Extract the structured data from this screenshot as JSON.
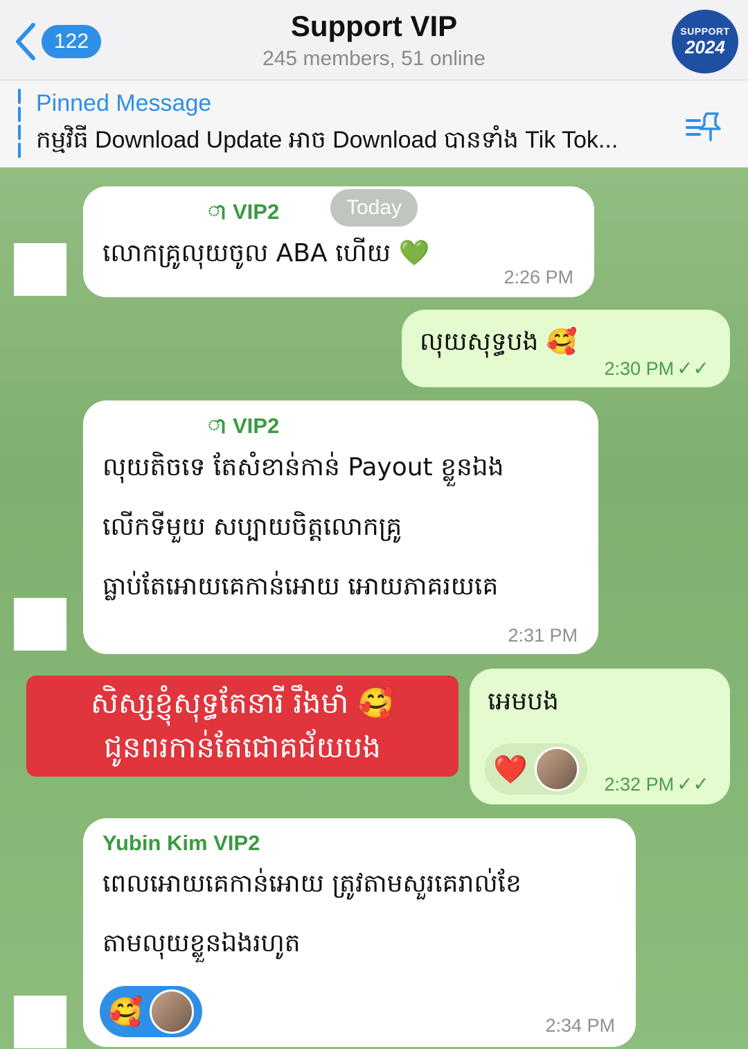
{
  "header": {
    "back_count": "122",
    "title": "Support VIP",
    "subtitle": "245 members, 51 online",
    "avatar_line1": "SUPPORT",
    "avatar_line2": "2024"
  },
  "pinned": {
    "title": "Pinned Message",
    "text": "កម្មវិធី Download Update អាច Download បានទាំង Tik Tok..."
  },
  "chat": {
    "date_pill": "Today",
    "messages": [
      {
        "sender": "ា VIP2",
        "text": "លោកគ្រូលុយចូល ABA ហើយ 💚",
        "time": "2:26 PM"
      },
      {
        "text": "លុយសុទ្ធបង 🥰",
        "time": "2:30 PM",
        "ticks": "✓✓"
      },
      {
        "sender": "ា VIP2",
        "lines": [
          "លុយតិចទេ តែសំខាន់កាន់ Payout ខ្លួនឯង",
          "លើកទីមួយ សប្បាយចិត្តលោកគ្រូ",
          "ធ្លាប់តែអោយគេកាន់អោយ អោយភាគរយគេ"
        ],
        "time": "2:31 PM"
      },
      {
        "text": "អេមបង",
        "time": "2:32 PM",
        "ticks": "✓✓",
        "reaction": "❤️"
      },
      {
        "sender": "Yubin Kim VIP2",
        "lines": [
          "ពេលអោយគេកាន់អោយ ត្រូវតាមសួរគេរាល់ខែ",
          "តាមលុយខ្លួនឯងរហូត"
        ],
        "time": "2:34 PM",
        "reaction": "🥰"
      }
    ],
    "banner_lines": [
      "សិស្សខ្ញុំសុទ្ធតែនារី រឹងមាំ 🥰",
      "ជូនពរកាន់តែជោគជ័យបង"
    ]
  },
  "colors": {
    "accent": "#2f8fe6",
    "sender_green": "#3a9b3f",
    "outgoing": "#e3fbcf",
    "banner": "#e0353d"
  }
}
